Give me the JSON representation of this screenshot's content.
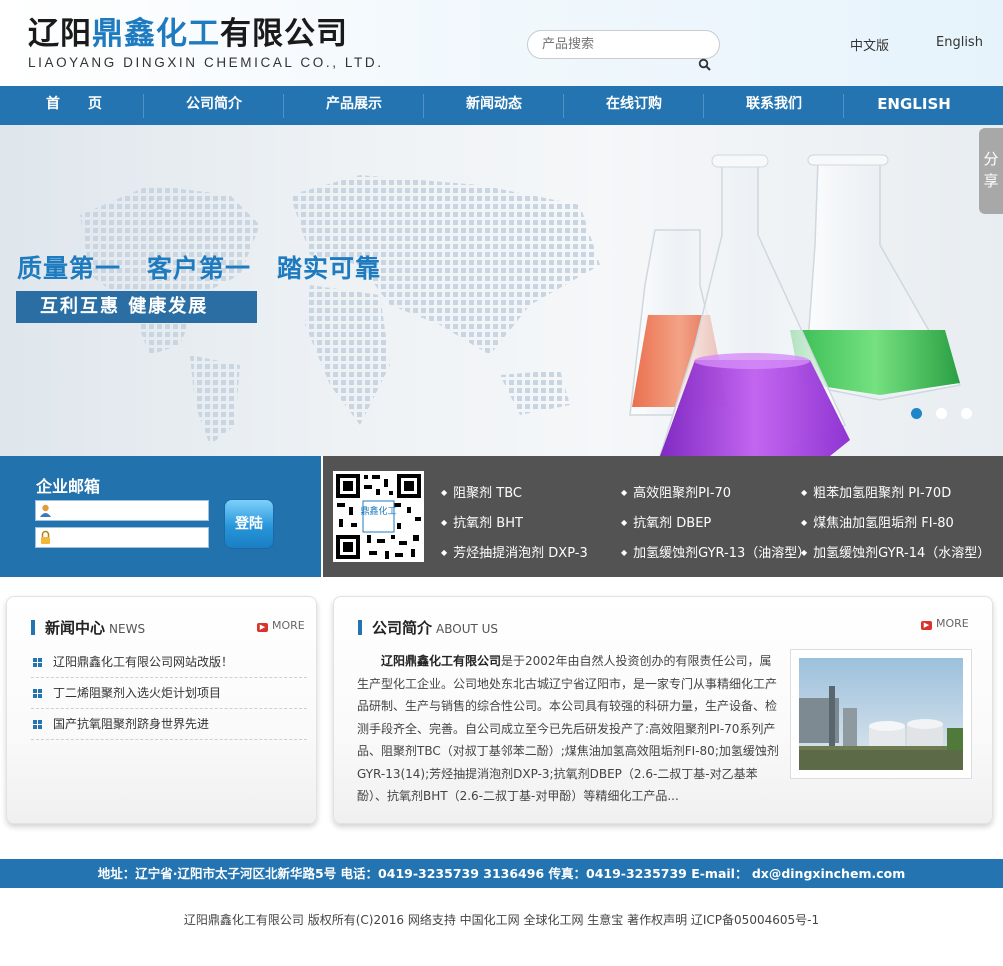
{
  "header": {
    "logo_cn_part1": "辽阳",
    "logo_cn_part2": "鼎鑫化工",
    "logo_cn_part3": "有限公司",
    "logo_en": "LIAOYANG DINGXIN CHEMICAL CO., LTD.",
    "search_placeholder": "产品搜索",
    "lang_cn": "中文版",
    "lang_en": "English"
  },
  "nav": {
    "items": [
      {
        "label": "首　　页"
      },
      {
        "label": "公司简介"
      },
      {
        "label": "产品展示"
      },
      {
        "label": "新闻动态"
      },
      {
        "label": "在线订购"
      },
      {
        "label": "联系我们"
      },
      {
        "label": "ENGLISH"
      }
    ]
  },
  "banner": {
    "slogan_main": "质量第一　客户第一　踏实可靠",
    "slogan_sub": "互利互惠  健康发展",
    "share_label": "分享",
    "slide_count": 3,
    "active_slide": 1
  },
  "mail": {
    "title": "企业邮箱",
    "login_label": "登陆"
  },
  "products": {
    "qr_text": "鼎鑫化工",
    "items": [
      "阻聚剂 TBC",
      "高效阻聚剂PI-70",
      "粗苯加氢阻聚剂 PI-70D",
      "抗氧剂 BHT",
      "抗氧剂 DBEP",
      "煤焦油加氢阻垢剂 FI-80",
      "芳烃抽提消泡剂 DXP-3",
      "加氢缓蚀剂GYR-13（油溶型）",
      "加氢缓蚀剂GYR-14（水溶型）"
    ]
  },
  "news": {
    "title": "新闻中心",
    "title_en": "NEWS",
    "more": "MORE",
    "items": [
      "辽阳鼎鑫化工有限公司网站改版！",
      "丁二烯阻聚剂入选火炬计划项目",
      "国产抗氧阻聚剂跻身世界先进"
    ]
  },
  "about": {
    "title": "公司简介",
    "title_en": "ABOUT US",
    "more": "MORE",
    "company": "辽阳鼎鑫化工有限公司",
    "text": "是于2002年由自然人投资创办的有限责任公司，属生产型化工企业。公司地处东北古城辽宁省辽阳市，是一家专门从事精细化工产品研制、生产与销售的综合性公司。本公司具有较强的科研力量，生产设备、检测手段齐全、完善。自公司成立至今已先后研发投产了:高效阻聚剂PI-70系列产品、阻聚剂TBC（对叔丁基邻苯二酚）;煤焦油加氢高效阻垢剂FI-80;加氢缓蚀剂GYR-13(14);芳烃抽提消泡剂DXP-3;抗氧剂DBEP（2.6-二叔丁基-对乙基苯酚）、抗氧剂BHT（2.6-二叔丁基-对甲酚）等精细化工产品..."
  },
  "footer": {
    "contact": "地址：辽宁省·辽阳市太子河区北新华路5号 电话：0419-3235739 3136496 传真：0419-3235739 E-mail： dx@dingxinchem.com",
    "copyright": "辽阳鼎鑫化工有限公司   版权所有(C)2016 网络支持  中国化工网   全球化工网   生意宝   著作权声明   辽ICP备05004605号-1"
  },
  "colors": {
    "brand_blue": "#2374b0",
    "logo_blue": "#1e7bc0",
    "product_panel": "#535353"
  }
}
